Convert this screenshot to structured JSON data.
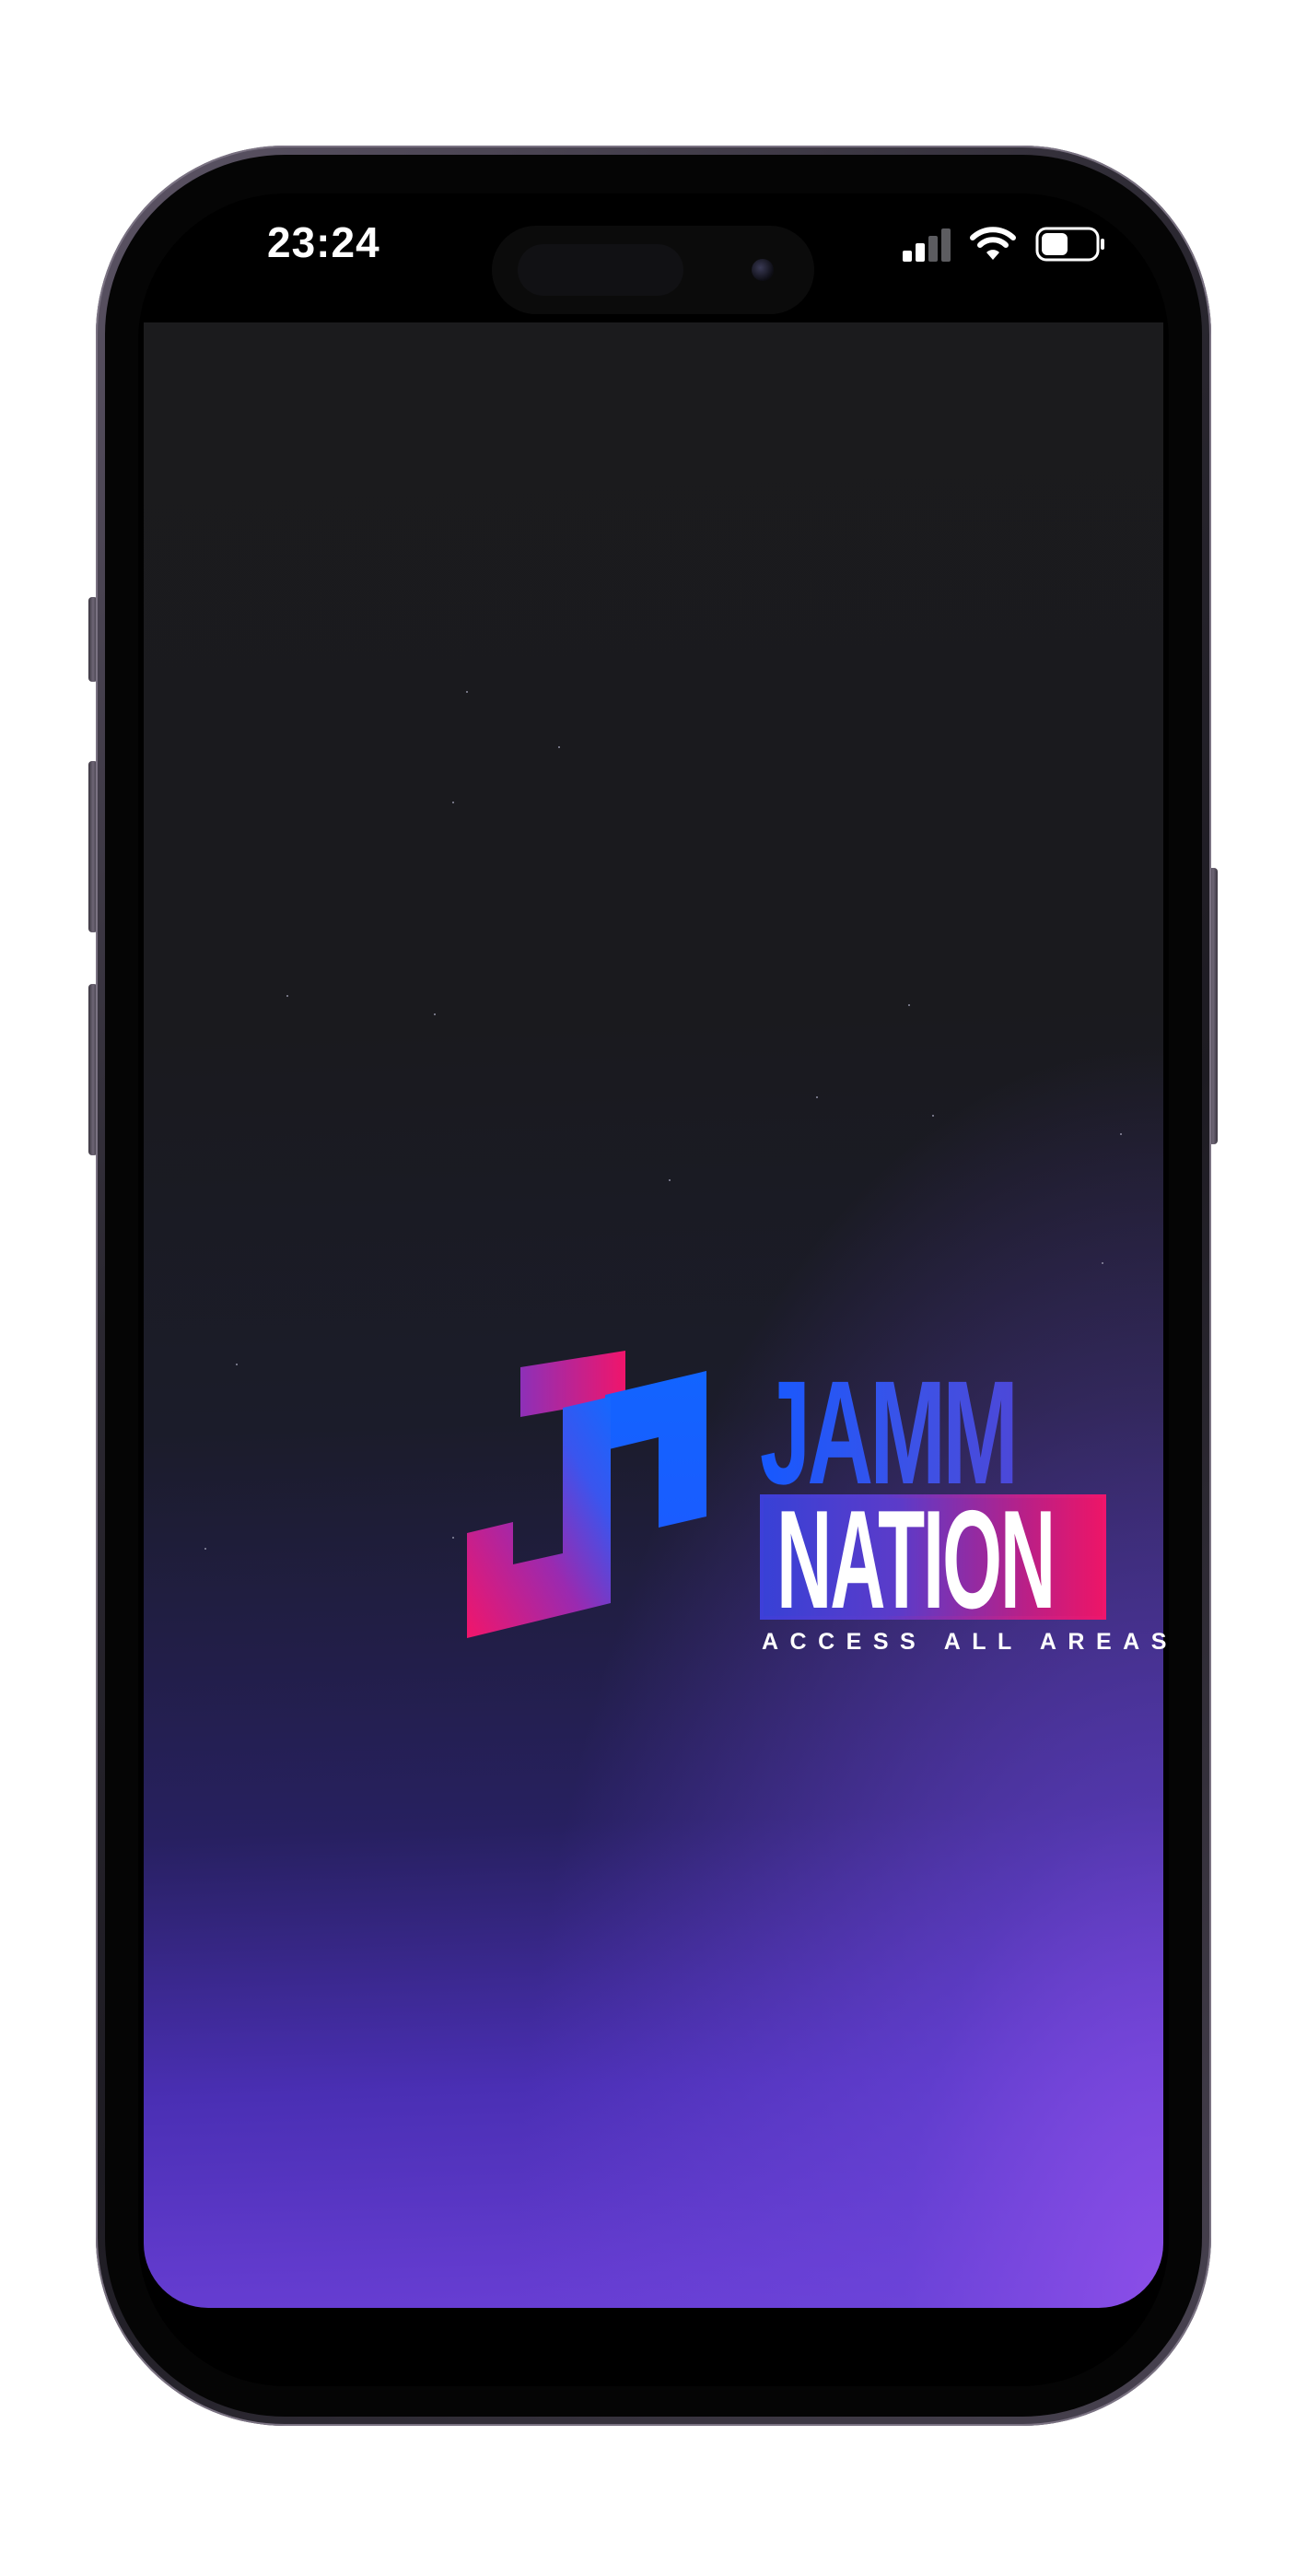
{
  "status_bar": {
    "time": "23:24",
    "signal_icon": "cellular-signal-icon",
    "wifi_icon": "wifi-icon",
    "battery_icon": "battery-icon",
    "battery_level": 0.5
  },
  "splash": {
    "brand_top": "JAMM",
    "brand_bottom": "NATION",
    "tagline": "ACCESS ALL AREAS",
    "logo_icon": "jamm-nation-logo-mark",
    "colors": {
      "background_top": "#1a1a1e",
      "background_bottom": "#7a45e0",
      "brand_blue": "#1659ff",
      "brand_pink": "#f0156b",
      "brand_purple": "#5a3ccc"
    }
  }
}
